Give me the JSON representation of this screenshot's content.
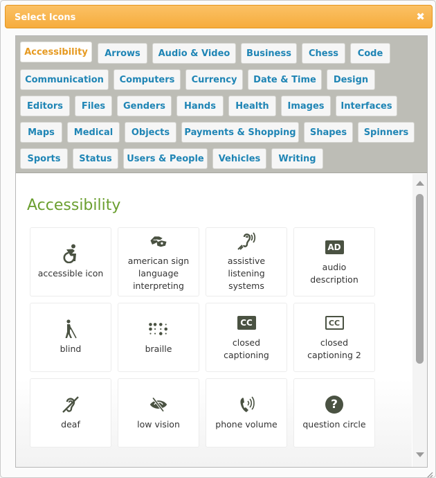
{
  "dialog": {
    "title": "Select Icons",
    "close_symbol": "✖"
  },
  "tabs": [
    {
      "label": "Accessibility",
      "active": true
    },
    {
      "label": "Arrows"
    },
    {
      "label": "Audio & Video"
    },
    {
      "label": "Business"
    },
    {
      "label": "Chess"
    },
    {
      "label": "Code"
    },
    {
      "label": "Communication"
    },
    {
      "label": "Computers"
    },
    {
      "label": "Currency"
    },
    {
      "label": "Date & Time"
    },
    {
      "label": "Design"
    },
    {
      "label": "Editors"
    },
    {
      "label": "Files"
    },
    {
      "label": "Genders"
    },
    {
      "label": "Hands"
    },
    {
      "label": "Health"
    },
    {
      "label": "Images"
    },
    {
      "label": "Interfaces"
    },
    {
      "label": "Maps"
    },
    {
      "label": "Medical"
    },
    {
      "label": "Objects"
    },
    {
      "label": "Payments & Shopping"
    },
    {
      "label": "Shapes"
    },
    {
      "label": "Spinners"
    },
    {
      "label": "Sports"
    },
    {
      "label": "Status"
    },
    {
      "label": "Users & People"
    },
    {
      "label": "Vehicles"
    },
    {
      "label": "Writing"
    }
  ],
  "section": {
    "title": "Accessibility",
    "icons": [
      {
        "label": "accessible icon",
        "icon": "accessible-icon"
      },
      {
        "label": "american sign language interpreting",
        "icon": "sign-language-icon"
      },
      {
        "label": "assistive listening systems",
        "icon": "assistive-listening-icon"
      },
      {
        "label": "audio description",
        "icon": "audio-description-icon",
        "glyph_text": "AD"
      },
      {
        "label": "blind",
        "icon": "blind-icon"
      },
      {
        "label": "braille",
        "icon": "braille-icon"
      },
      {
        "label": "closed captioning",
        "icon": "closed-captioning-icon",
        "glyph_text": "CC"
      },
      {
        "label": "closed captioning 2",
        "icon": "closed-captioning-outline-icon",
        "glyph_text": "CC"
      },
      {
        "label": "deaf",
        "icon": "deaf-icon"
      },
      {
        "label": "low vision",
        "icon": "low-vision-icon"
      },
      {
        "label": "phone volume",
        "icon": "phone-volume-icon"
      },
      {
        "label": "question circle",
        "icon": "question-circle-icon",
        "glyph_text": "?"
      }
    ]
  },
  "colors": {
    "title_bar": "#f6ac3d",
    "tab_text": "#1f85b5",
    "tab_active_text": "#e69a21",
    "section_title": "#6b9f30",
    "icon_fill": "#4a5242"
  }
}
